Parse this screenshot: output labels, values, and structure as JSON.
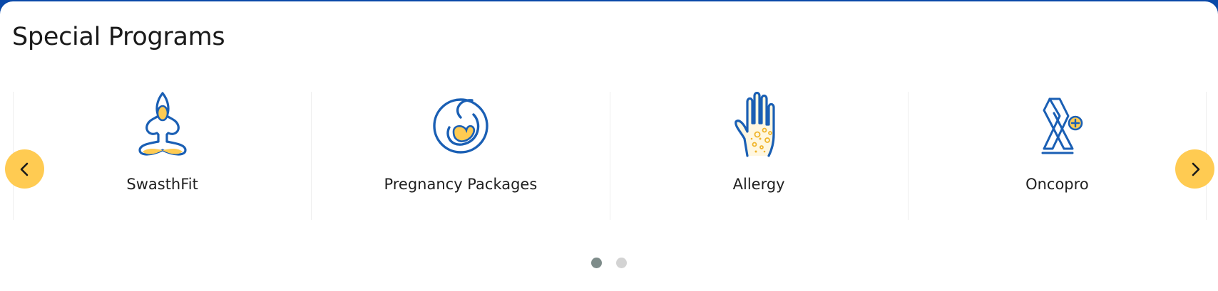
{
  "section": {
    "title": "Special Programs"
  },
  "carousel": {
    "items": [
      {
        "label": "SwasthFit",
        "icon": "yoga-meditation-icon"
      },
      {
        "label": "Pregnancy Packages",
        "icon": "pregnancy-fetus-icon"
      },
      {
        "label": "Allergy",
        "icon": "allergy-hand-icon"
      },
      {
        "label": "Oncopro",
        "icon": "cancer-ribbon-icon"
      }
    ],
    "prev_icon": "chevron-left-icon",
    "next_icon": "chevron-right-icon",
    "pages": 2,
    "active_page": 1
  },
  "colors": {
    "brand_blue": "#0a49a8",
    "icon_blue": "#1a5fb4",
    "accent_yellow": "#ffcb52",
    "dot_active": "#7e8c8a",
    "dot_inactive": "#d3d3d3"
  }
}
